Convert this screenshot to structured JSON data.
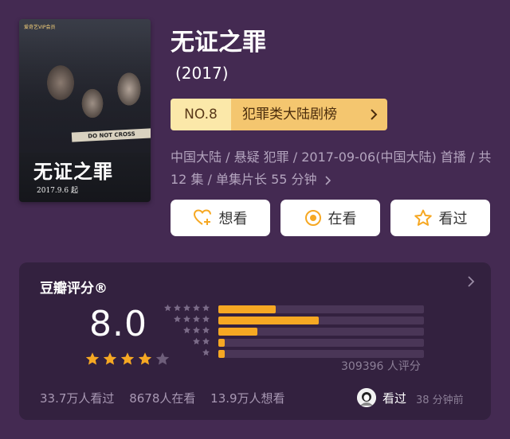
{
  "movie": {
    "title": "无证之罪",
    "year": "(2017)",
    "poster": {
      "tag": "爱奇艺VIP会员",
      "tape_text": "DO NOT CROSS",
      "title": "无证之罪",
      "date": "2017.9.6 起"
    }
  },
  "rank": {
    "number": "NO.8",
    "list_name": "犯罪类大陆剧榜",
    "chevron": "chevron-right-icon"
  },
  "meta": {
    "text": "中国大陆 / 悬疑 犯罪 / 2017-09-06(中国大陆) 首播 / 共 12 集 / 单集片长 55 分钟"
  },
  "actions": [
    {
      "label": "想看",
      "icon": "heart-plus-icon"
    },
    {
      "label": "在看",
      "icon": "target-icon"
    },
    {
      "label": "看过",
      "icon": "star-outline-icon"
    }
  ],
  "rating": {
    "title": "豆瓣评分®",
    "score": "8.0",
    "stars_filled": 4,
    "stars_total": 5,
    "distribution": [
      {
        "stars": 5,
        "fraction": 0.28
      },
      {
        "stars": 4,
        "fraction": 0.49
      },
      {
        "stars": 3,
        "fraction": 0.19
      },
      {
        "stars": 2,
        "fraction": 0.03
      },
      {
        "stars": 1,
        "fraction": 0.03
      }
    ],
    "count_text": "309396 人评分"
  },
  "stats": {
    "watched": "33.7万人看过",
    "watching": "8678人在看",
    "want": "13.9万人想看"
  },
  "user": {
    "status": "看过",
    "time": "38 分钟前"
  },
  "colors": {
    "background": "#442a52",
    "card": "#33213f",
    "accent": "#f6a823",
    "rank_light": "#fbe8a9",
    "rank_dark": "#f4c66f"
  }
}
